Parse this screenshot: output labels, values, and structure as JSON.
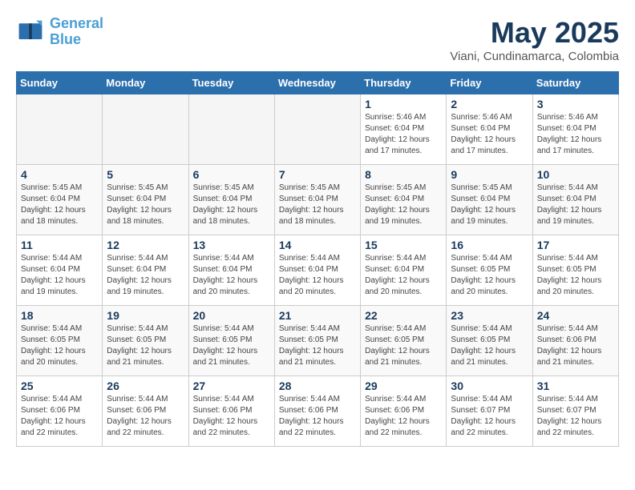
{
  "logo": {
    "line1": "General",
    "line2": "Blue"
  },
  "title": "May 2025",
  "subtitle": "Viani, Cundinamarca, Colombia",
  "weekdays": [
    "Sunday",
    "Monday",
    "Tuesday",
    "Wednesday",
    "Thursday",
    "Friday",
    "Saturday"
  ],
  "weeks": [
    [
      {
        "day": "",
        "info": ""
      },
      {
        "day": "",
        "info": ""
      },
      {
        "day": "",
        "info": ""
      },
      {
        "day": "",
        "info": ""
      },
      {
        "day": "1",
        "info": "Sunrise: 5:46 AM\nSunset: 6:04 PM\nDaylight: 12 hours\nand 17 minutes."
      },
      {
        "day": "2",
        "info": "Sunrise: 5:46 AM\nSunset: 6:04 PM\nDaylight: 12 hours\nand 17 minutes."
      },
      {
        "day": "3",
        "info": "Sunrise: 5:46 AM\nSunset: 6:04 PM\nDaylight: 12 hours\nand 17 minutes."
      }
    ],
    [
      {
        "day": "4",
        "info": "Sunrise: 5:45 AM\nSunset: 6:04 PM\nDaylight: 12 hours\nand 18 minutes."
      },
      {
        "day": "5",
        "info": "Sunrise: 5:45 AM\nSunset: 6:04 PM\nDaylight: 12 hours\nand 18 minutes."
      },
      {
        "day": "6",
        "info": "Sunrise: 5:45 AM\nSunset: 6:04 PM\nDaylight: 12 hours\nand 18 minutes."
      },
      {
        "day": "7",
        "info": "Sunrise: 5:45 AM\nSunset: 6:04 PM\nDaylight: 12 hours\nand 18 minutes."
      },
      {
        "day": "8",
        "info": "Sunrise: 5:45 AM\nSunset: 6:04 PM\nDaylight: 12 hours\nand 19 minutes."
      },
      {
        "day": "9",
        "info": "Sunrise: 5:45 AM\nSunset: 6:04 PM\nDaylight: 12 hours\nand 19 minutes."
      },
      {
        "day": "10",
        "info": "Sunrise: 5:44 AM\nSunset: 6:04 PM\nDaylight: 12 hours\nand 19 minutes."
      }
    ],
    [
      {
        "day": "11",
        "info": "Sunrise: 5:44 AM\nSunset: 6:04 PM\nDaylight: 12 hours\nand 19 minutes."
      },
      {
        "day": "12",
        "info": "Sunrise: 5:44 AM\nSunset: 6:04 PM\nDaylight: 12 hours\nand 19 minutes."
      },
      {
        "day": "13",
        "info": "Sunrise: 5:44 AM\nSunset: 6:04 PM\nDaylight: 12 hours\nand 20 minutes."
      },
      {
        "day": "14",
        "info": "Sunrise: 5:44 AM\nSunset: 6:04 PM\nDaylight: 12 hours\nand 20 minutes."
      },
      {
        "day": "15",
        "info": "Sunrise: 5:44 AM\nSunset: 6:04 PM\nDaylight: 12 hours\nand 20 minutes."
      },
      {
        "day": "16",
        "info": "Sunrise: 5:44 AM\nSunset: 6:05 PM\nDaylight: 12 hours\nand 20 minutes."
      },
      {
        "day": "17",
        "info": "Sunrise: 5:44 AM\nSunset: 6:05 PM\nDaylight: 12 hours\nand 20 minutes."
      }
    ],
    [
      {
        "day": "18",
        "info": "Sunrise: 5:44 AM\nSunset: 6:05 PM\nDaylight: 12 hours\nand 20 minutes."
      },
      {
        "day": "19",
        "info": "Sunrise: 5:44 AM\nSunset: 6:05 PM\nDaylight: 12 hours\nand 21 minutes."
      },
      {
        "day": "20",
        "info": "Sunrise: 5:44 AM\nSunset: 6:05 PM\nDaylight: 12 hours\nand 21 minutes."
      },
      {
        "day": "21",
        "info": "Sunrise: 5:44 AM\nSunset: 6:05 PM\nDaylight: 12 hours\nand 21 minutes."
      },
      {
        "day": "22",
        "info": "Sunrise: 5:44 AM\nSunset: 6:05 PM\nDaylight: 12 hours\nand 21 minutes."
      },
      {
        "day": "23",
        "info": "Sunrise: 5:44 AM\nSunset: 6:05 PM\nDaylight: 12 hours\nand 21 minutes."
      },
      {
        "day": "24",
        "info": "Sunrise: 5:44 AM\nSunset: 6:06 PM\nDaylight: 12 hours\nand 21 minutes."
      }
    ],
    [
      {
        "day": "25",
        "info": "Sunrise: 5:44 AM\nSunset: 6:06 PM\nDaylight: 12 hours\nand 22 minutes."
      },
      {
        "day": "26",
        "info": "Sunrise: 5:44 AM\nSunset: 6:06 PM\nDaylight: 12 hours\nand 22 minutes."
      },
      {
        "day": "27",
        "info": "Sunrise: 5:44 AM\nSunset: 6:06 PM\nDaylight: 12 hours\nand 22 minutes."
      },
      {
        "day": "28",
        "info": "Sunrise: 5:44 AM\nSunset: 6:06 PM\nDaylight: 12 hours\nand 22 minutes."
      },
      {
        "day": "29",
        "info": "Sunrise: 5:44 AM\nSunset: 6:06 PM\nDaylight: 12 hours\nand 22 minutes."
      },
      {
        "day": "30",
        "info": "Sunrise: 5:44 AM\nSunset: 6:07 PM\nDaylight: 12 hours\nand 22 minutes."
      },
      {
        "day": "31",
        "info": "Sunrise: 5:44 AM\nSunset: 6:07 PM\nDaylight: 12 hours\nand 22 minutes."
      }
    ]
  ]
}
